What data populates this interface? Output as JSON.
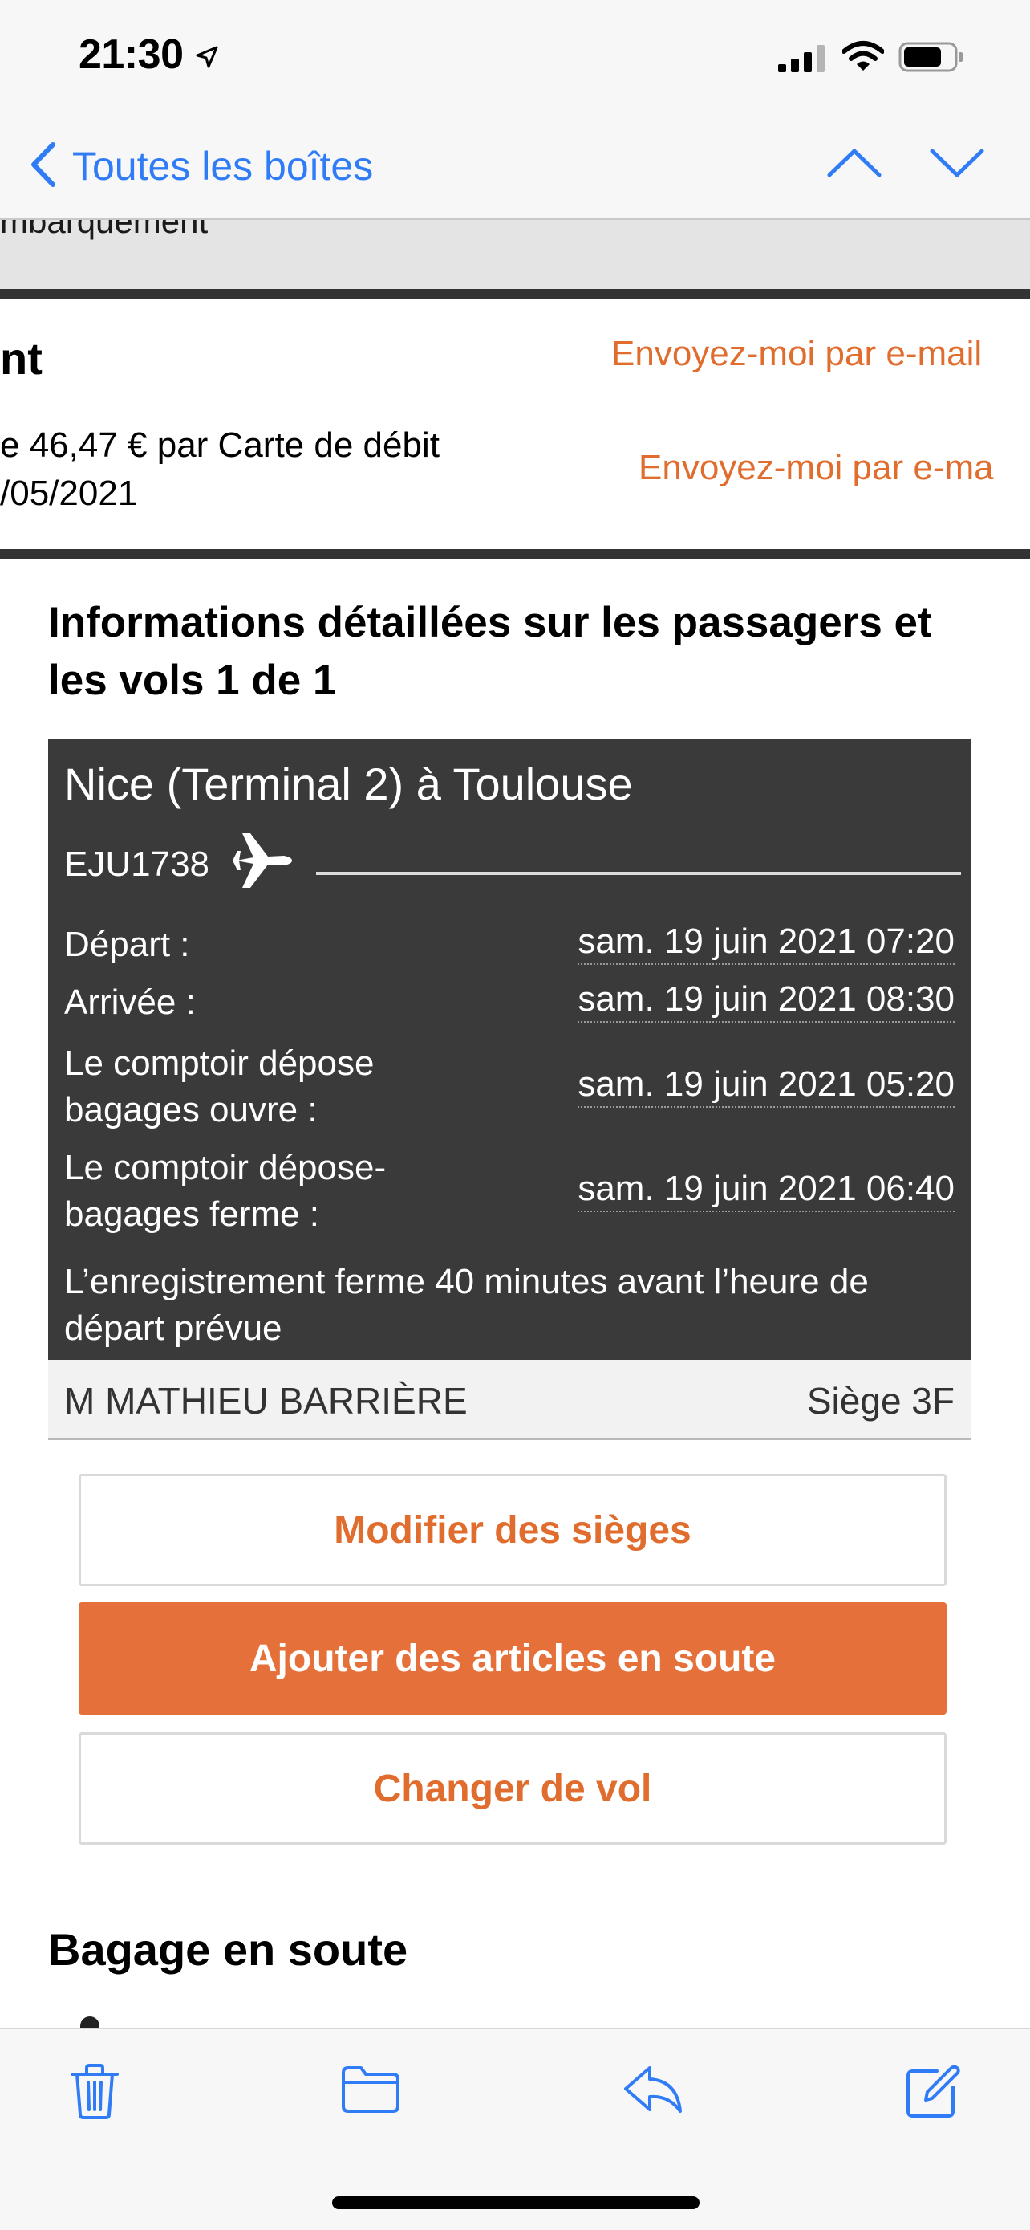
{
  "status_bar": {
    "time": "21:30",
    "icons": [
      "location-arrow-icon",
      "cellular-signal-icon",
      "wifi-icon",
      "battery-icon"
    ]
  },
  "nav": {
    "back_label": "Toutes les boîtes",
    "icons": [
      "chevron-left-icon",
      "chevron-up-icon",
      "chevron-down-icon"
    ]
  },
  "email": {
    "header_fragment": "mbarquement",
    "payment": {
      "title_fragment": "nt",
      "line1": "e 46,47 € par Carte de débit",
      "line2": "/05/2021",
      "email_link_1": "Envoyez-moi par e-mail",
      "email_link_2": "Envoyez-moi par e-ma"
    },
    "details_heading": "Informations détaillées sur les passagers et les vols 1 de 1",
    "flight": {
      "route": "Nice (Terminal 2) à Toulouse",
      "flight_number": "EJU1738",
      "rows": [
        {
          "label": "Départ :",
          "value": "sam. 19 juin 2021 07:20"
        },
        {
          "label": "Arrivée :",
          "value": "sam. 19 juin 2021 08:30"
        },
        {
          "label": "Le comptoir dépose bagages ouvre :",
          "value": "sam. 19 juin 2021 05:20"
        },
        {
          "label": "Le comptoir dépose-bagages ferme :",
          "value": "sam. 19 juin 2021 06:40"
        }
      ],
      "checkin_note": "L’enregistrement ferme 40 minutes avant l’heure de départ prévue"
    },
    "passenger": {
      "name": "M MATHIEU BARRIÈRE",
      "seat": "Siège 3F"
    },
    "buttons": {
      "modify_seats": "Modifier des sièges",
      "add_hold_items": "Ajouter des articles en soute",
      "change_flight": "Changer de vol"
    },
    "bagage_heading": "Bagage en soute"
  },
  "toolbar": {
    "icons": [
      "trash-icon",
      "folder-icon",
      "reply-icon",
      "compose-icon"
    ]
  },
  "colors": {
    "accent_blue": "#2f7cf6",
    "accent_orange": "#e06d2e",
    "card_dark": "#3a3a3a"
  }
}
